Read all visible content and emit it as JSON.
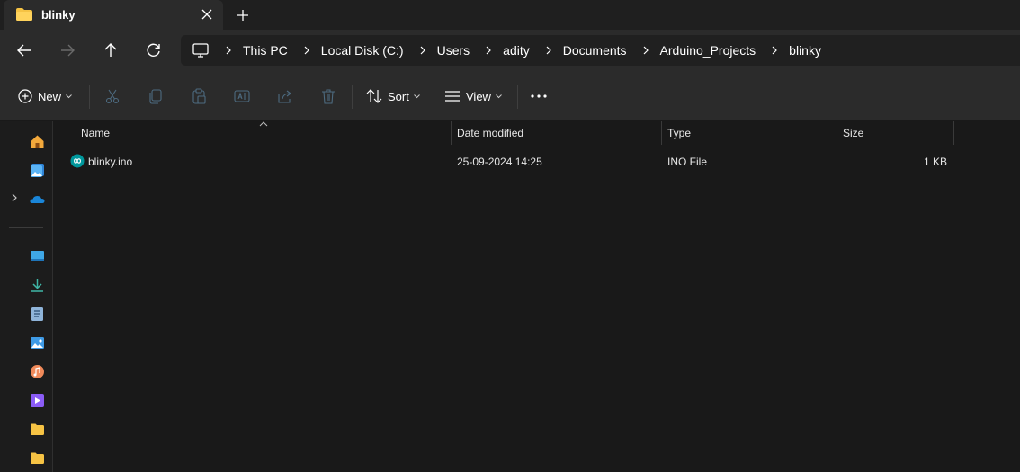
{
  "tab": {
    "title": "blinky"
  },
  "breadcrumb": [
    "This PC",
    "Local Disk (C:)",
    "Users",
    "adity",
    "Documents",
    "Arduino_Projects",
    "blinky"
  ],
  "commands": {
    "new_label": "New",
    "sort_label": "Sort",
    "view_label": "View"
  },
  "columns": {
    "name": "Name",
    "date": "Date modified",
    "type": "Type",
    "size": "Size"
  },
  "files": [
    {
      "name": "blinky.ino",
      "date": "25-09-2024 14:25",
      "type": "INO File",
      "size": "1 KB"
    }
  ],
  "colors": {
    "folder": "#f6c344",
    "accent": "#4cc2ff",
    "arduino": "#00979c"
  },
  "icons": [
    "folder-icon",
    "close-icon",
    "plus-icon",
    "back-arrow-icon",
    "forward-arrow-icon",
    "up-arrow-icon",
    "refresh-icon",
    "computer-icon",
    "chevron-right-icon",
    "cut-icon",
    "copy-icon",
    "paste-icon",
    "rename-icon",
    "share-icon",
    "delete-icon",
    "sort-icon",
    "view-icon",
    "more-icon",
    "home-icon",
    "gallery-icon",
    "onedrive-icon",
    "desktop-icon",
    "downloads-icon",
    "documents-icon",
    "pictures-icon",
    "music-icon",
    "videos-icon",
    "arduino-icon"
  ]
}
